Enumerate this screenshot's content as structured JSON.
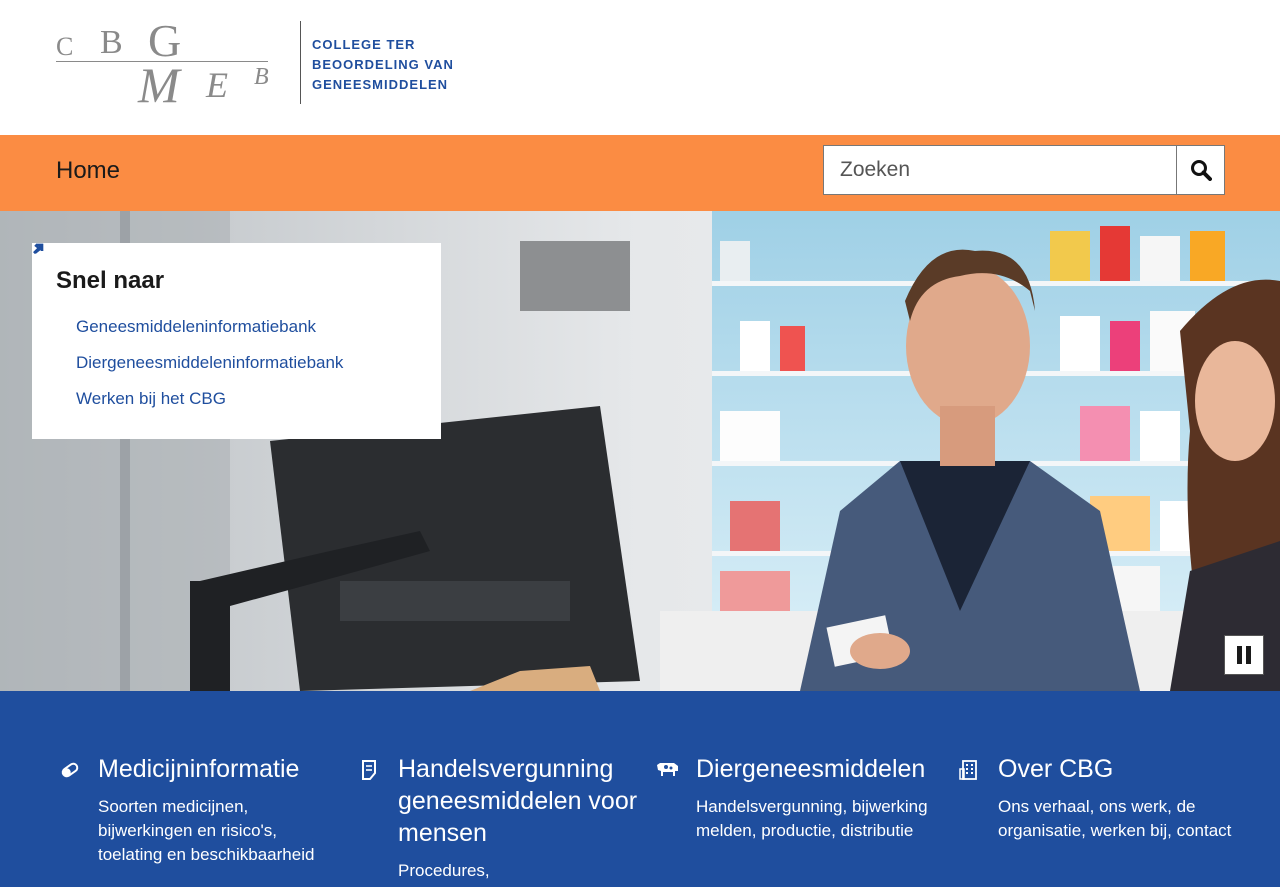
{
  "header": {
    "logo_mark": [
      "C",
      "B",
      "G",
      "M",
      "E",
      "B"
    ],
    "logo_text": [
      "COLLEGE TER",
      "BEOORDELING VAN",
      "GENEESMIDDELEN"
    ]
  },
  "nav": {
    "home_label": "Home",
    "search_placeholder": "Zoeken",
    "search_icon": "search-icon"
  },
  "hero": {
    "quick_title": "Snel naar",
    "quick_links": [
      {
        "label": "Geneesmiddeleninformatiebank",
        "icon": "external-arrow-icon"
      },
      {
        "label": "Diergeneesmiddeleninformatiebank",
        "icon": "external-arrow-icon"
      },
      {
        "label": "Werken bij het CBG",
        "icon": "chevron-right-icon"
      }
    ],
    "pause_icon": "pause-icon"
  },
  "tiles": [
    {
      "icon": "pill-icon",
      "title": "Medicijninformatie",
      "description": "Soorten medicijnen, bijwerkingen en risico's, toelating en beschikbaarheid"
    },
    {
      "icon": "document-icon",
      "title": "Handelsvergunning geneesmiddelen voor mensen",
      "description": "Procedures,"
    },
    {
      "icon": "cow-icon",
      "title": "Diergeneesmiddelen",
      "description": "Handelsvergunning, bijwerking melden, productie, distributie"
    },
    {
      "icon": "building-icon",
      "title": "Over CBG",
      "description": "Ons verhaal, ons werk, de organisatie, werken bij, contact"
    }
  ],
  "colors": {
    "nav_orange": "#fb8c43",
    "brand_blue": "#1f4e9e",
    "link_blue": "#1f4e9e"
  }
}
